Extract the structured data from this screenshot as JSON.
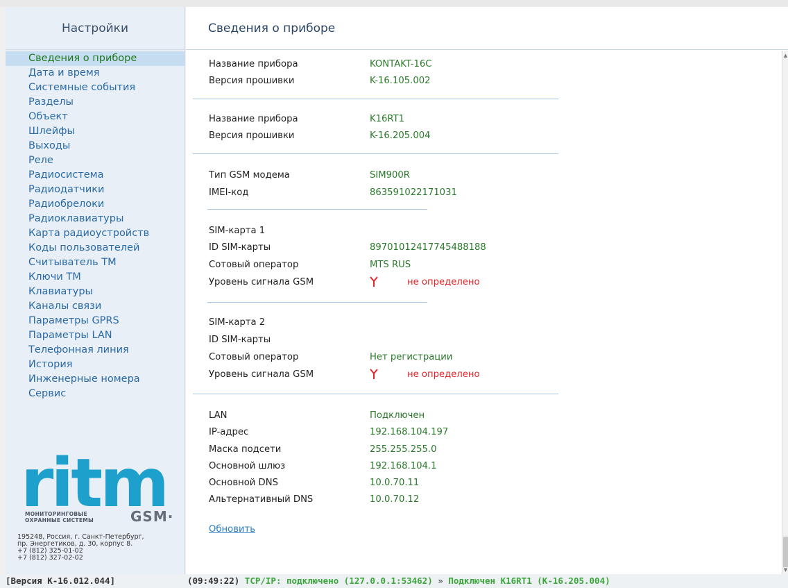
{
  "sidebar": {
    "title": "Настройки",
    "items": [
      {
        "label": "Сведения о приборе",
        "active": true
      },
      {
        "label": "Дата и время"
      },
      {
        "label": "Системные события"
      },
      {
        "label": "Разделы"
      },
      {
        "label": "Объект"
      },
      {
        "label": "Шлейфы"
      },
      {
        "label": "Выходы"
      },
      {
        "label": "Реле"
      },
      {
        "label": "Радиосистема"
      },
      {
        "label": "Радиодатчики"
      },
      {
        "label": "Радиобрелоки"
      },
      {
        "label": "Радиоклавиатуры"
      },
      {
        "label": "Карта радиоустройств"
      },
      {
        "label": "Коды пользователей"
      },
      {
        "label": "Считыватель ТМ"
      },
      {
        "label": "Ключи ТМ"
      },
      {
        "label": "Клавиатуры"
      },
      {
        "label": "Каналы связи"
      },
      {
        "label": "Параметры GPRS"
      },
      {
        "label": "Параметры LAN"
      },
      {
        "label": "Телефонная линия"
      },
      {
        "label": "История"
      },
      {
        "label": "Инженерные номера"
      },
      {
        "label": "Сервис"
      }
    ],
    "logo": {
      "word": "ritm",
      "subtitle_line1": "МОНИТОРИНГОВЫЕ",
      "subtitle_line2": "ОХРАННЫЕ СИСТЕМЫ",
      "gsm": "GSM·"
    },
    "address": {
      "line1": "195248, Россия, г. Санкт-Петербург,",
      "line2": "пр. Энергетиков, д. 30, корпус 8.",
      "line3": "+7 (812) 325-01-02",
      "line4": "+7 (812) 327-02-02"
    }
  },
  "main": {
    "title": "Сведения о приборе",
    "device1": {
      "name_label": "Название прибора",
      "name_value": "KONTAKT-16C",
      "fw_label": "Версия прошивки",
      "fw_value": "K-16.105.002"
    },
    "device2": {
      "name_label": "Название прибора",
      "name_value": "K16RT1",
      "fw_label": "Версия прошивки",
      "fw_value": "K-16.205.004"
    },
    "gsm": {
      "modem_label": "Тип GSM модема",
      "modem_value": "SIM900R",
      "imei_label": "IMEI-код",
      "imei_value": "863591022171031"
    },
    "sim1": {
      "header": "SIM-карта 1",
      "id_label": "ID SIM-карты",
      "id_value": "89701012417745488188",
      "operator_label": "Сотовый оператор",
      "operator_value": "MTS RUS",
      "signal_label": "Уровень сигнала GSM",
      "signal_value": "не определено",
      "signal_icon": "antenna-icon"
    },
    "sim2": {
      "header": "SIM-карта 2",
      "id_label": "ID SIM-карты",
      "id_value": "",
      "operator_label": "Сотовый оператор",
      "operator_value": "Нет регистрации",
      "signal_label": "Уровень сигнала GSM",
      "signal_value": "не определено",
      "signal_icon": "antenna-icon"
    },
    "lan": {
      "lan_label": "LAN",
      "lan_value": "Подключен",
      "ip_label": "IP-адрес",
      "ip_value": "192.168.104.197",
      "mask_label": "Маска подсети",
      "mask_value": "255.255.255.0",
      "gw_label": "Основной шлюз",
      "gw_value": "192.168.104.1",
      "dns1_label": "Основной DNS",
      "dns1_value": "10.0.70.11",
      "dns2_label": "Альтернативный DNS",
      "dns2_value": "10.0.70.12"
    },
    "refresh_label": "Обновить"
  },
  "statusbar": {
    "version": "[Версия К-16.012.044]",
    "time": "(09:49:22)",
    "tcp": "TCP/IP: подключено (127.0.0.1:53462)",
    "arrow": "»",
    "connected": "Подключен K16RT1 (K-16.205.004)"
  },
  "colors": {
    "value_green": "#2b7a2b",
    "error_red": "#e0262a",
    "link_blue": "#2f7fc2",
    "logo_blue": "#1da0cc",
    "active_bg": "#c6dcf0"
  }
}
